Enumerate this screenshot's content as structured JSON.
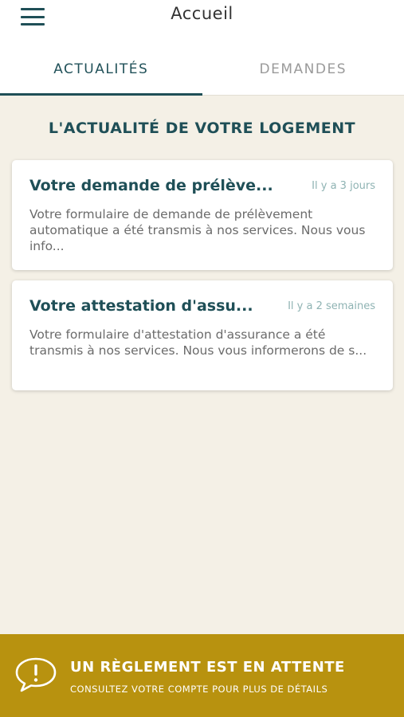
{
  "header": {
    "title": "Accueil",
    "menu_icon": "hamburger-menu-icon"
  },
  "tabs": [
    {
      "label": "ACTUALITÉS",
      "active": true
    },
    {
      "label": "DEMANDES",
      "active": false
    }
  ],
  "section": {
    "title": "L'ACTUALITÉ DE VOTRE LOGEMENT"
  },
  "news": [
    {
      "title": "Votre demande de prélève...",
      "time": "Il y a 3 jours",
      "body": "Votre formulaire de demande de prélèvement automatique a été transmis à nos services. Nous vous info..."
    },
    {
      "title": "Votre attestation d'assu...",
      "time": "Il y a 2 semaines",
      "body": "Votre formulaire d'attestation d'assurance a été transmis à nos services. Nous vous informerons de s..."
    }
  ],
  "banner": {
    "icon": "alert-speech-bubble-icon",
    "title": "UN RÈGLEMENT EST EN ATTENTE",
    "subtitle": "CONSULTEZ VOTRE COMPTE POUR PLUS DE DÉTAILS"
  },
  "colors": {
    "primary": "#1f4f57",
    "background": "#f4f0e6",
    "banner": "#b8920f",
    "timestamp": "#8fb3b3"
  }
}
